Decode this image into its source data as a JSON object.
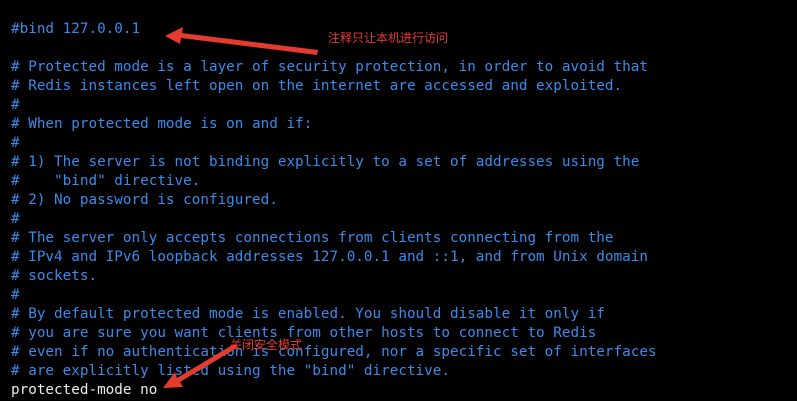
{
  "terminal": {
    "lines": [
      "#bind 127.0.0.1",
      "",
      "# Protected mode is a layer of security protection, in order to avoid that",
      "# Redis instances left open on the internet are accessed and exploited.",
      "#",
      "# When protected mode is on and if:",
      "#",
      "# 1) The server is not binding explicitly to a set of addresses using the",
      "#    \"bind\" directive.",
      "# 2) No password is configured.",
      "#",
      "# The server only accepts connections from clients connecting from the",
      "# IPv4 and IPv6 loopback addresses 127.0.0.1 and ::1, and from Unix domain",
      "# sockets.",
      "#",
      "# By default protected mode is enabled. You should disable it only if",
      "# you are sure you want clients from other hosts to connect to Redis",
      "# even if no authentication is configured, nor a specific set of interfaces",
      "# are explicitly listed using the \"bind\" directive.",
      "protected-mode no"
    ]
  },
  "annotations": {
    "bind_note": "注释只让本机进行访问",
    "protected_mode_note": "关闭安全模式"
  },
  "colors": {
    "background": "#000000",
    "comment": "#3a8bea",
    "plain": "#ececec",
    "annotation": "#e53a2e"
  }
}
